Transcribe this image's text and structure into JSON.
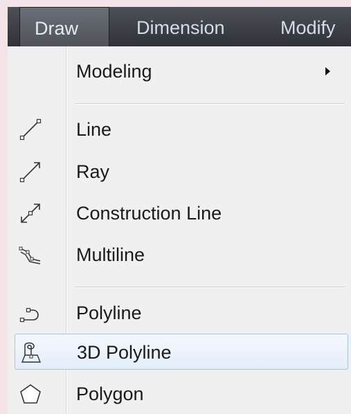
{
  "menubar": {
    "items": [
      "Draw",
      "Dimension",
      "Modify"
    ]
  },
  "menu": {
    "modeling": "Modeling",
    "line": "Line",
    "ray": "Ray",
    "construction_line": "Construction Line",
    "multiline": "Multiline",
    "polyline": "Polyline",
    "polyline_3d": "3D Polyline",
    "polygon": "Polygon"
  },
  "icons": {
    "line": "line-icon",
    "ray": "ray-icon",
    "construction_line": "construction-line-icon",
    "multiline": "multiline-icon",
    "polyline": "polyline-icon",
    "polyline_3d": "3d-polyline-icon",
    "polygon": "polygon-icon"
  },
  "colors": {
    "menubar": "#3e4148",
    "menubar_text": "#d5dde8",
    "highlight_border": "#a6c4e6",
    "highlight_fill": "#e8f1fb"
  }
}
